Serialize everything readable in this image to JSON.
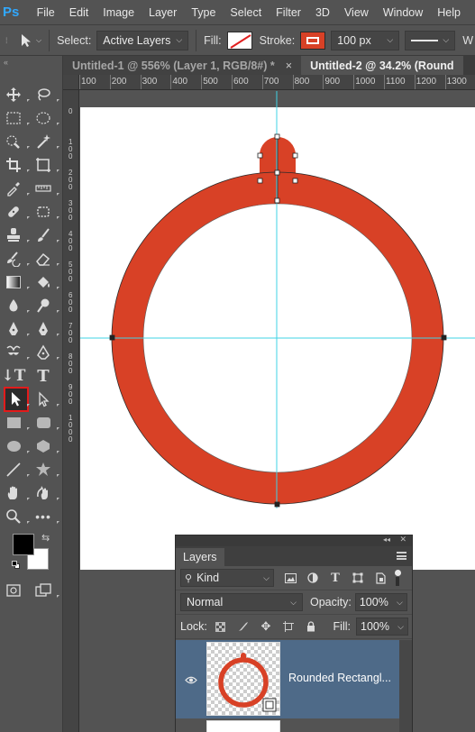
{
  "app": {
    "logo": "Ps"
  },
  "menu": [
    "File",
    "Edit",
    "Image",
    "Layer",
    "Type",
    "Select",
    "Filter",
    "3D",
    "View",
    "Window",
    "Help"
  ],
  "options": {
    "select_label": "Select:",
    "select_value": "Active Layers",
    "fill_label": "Fill:",
    "stroke_label": "Stroke:",
    "stroke_width": "100 px",
    "overflow_label": "W"
  },
  "tabs": [
    {
      "label": "Untitled-1 @ 556% (Layer 1, RGB/8#) *",
      "active": false,
      "close": "×"
    },
    {
      "label": "Untitled-2 @ 34.2% (Round",
      "active": true
    }
  ],
  "ruler": {
    "h_ticks": [
      "100",
      "200",
      "300",
      "400",
      "500",
      "600",
      "700",
      "800",
      "900",
      "1000",
      "1100",
      "1200",
      "1300"
    ],
    "v_ticks": [
      "0",
      "1 0 0",
      "2 0 0",
      "3 0 0",
      "4 0 0",
      "5 0 0",
      "6 0 0",
      "7 0 0",
      "8 0 0",
      "9 0 0",
      "1 0 0 0"
    ],
    "corner": "0"
  },
  "canvas": {
    "shape_color": "#d84126",
    "guide_color": "#3fd3e6",
    "page_color": "#ffffff"
  },
  "tools": {
    "selected": "path-selection-tool",
    "foreground_color": "#000000",
    "background_color": "#ffffff"
  },
  "layers_panel": {
    "title": "Layers",
    "filter_value": "Kind",
    "blend_mode": "Normal",
    "opacity_label": "Opacity:",
    "opacity_value": "100%",
    "lock_label": "Lock:",
    "fill_label": "Fill:",
    "fill_value": "100%",
    "layer_name": "Rounded Rectangl..."
  }
}
